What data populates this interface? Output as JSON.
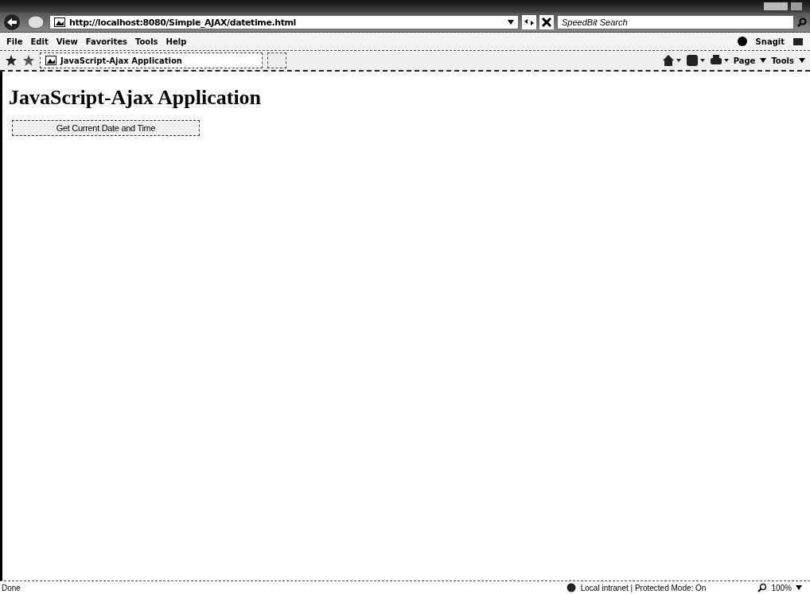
{
  "address_bar": {
    "url": "http://localhost:8080/Simple_AJAX/datetime.html"
  },
  "search": {
    "placeholder": "SpeedBit Search"
  },
  "menu": [
    "File",
    "Edit",
    "View",
    "Favorites",
    "Tools",
    "Help"
  ],
  "toolbar_extra": "Snagit",
  "tab": {
    "title": "JavaScript-Ajax Application",
    "selected": true
  },
  "command_bar": [
    "Page",
    "Tools"
  ],
  "page": {
    "heading": "JavaScript-Ajax Application",
    "button": "Get Current Date and Time"
  },
  "status_bar": {
    "status": "Done",
    "zone": "Local intranet | Protected Mode: On",
    "zoom": "100%"
  }
}
